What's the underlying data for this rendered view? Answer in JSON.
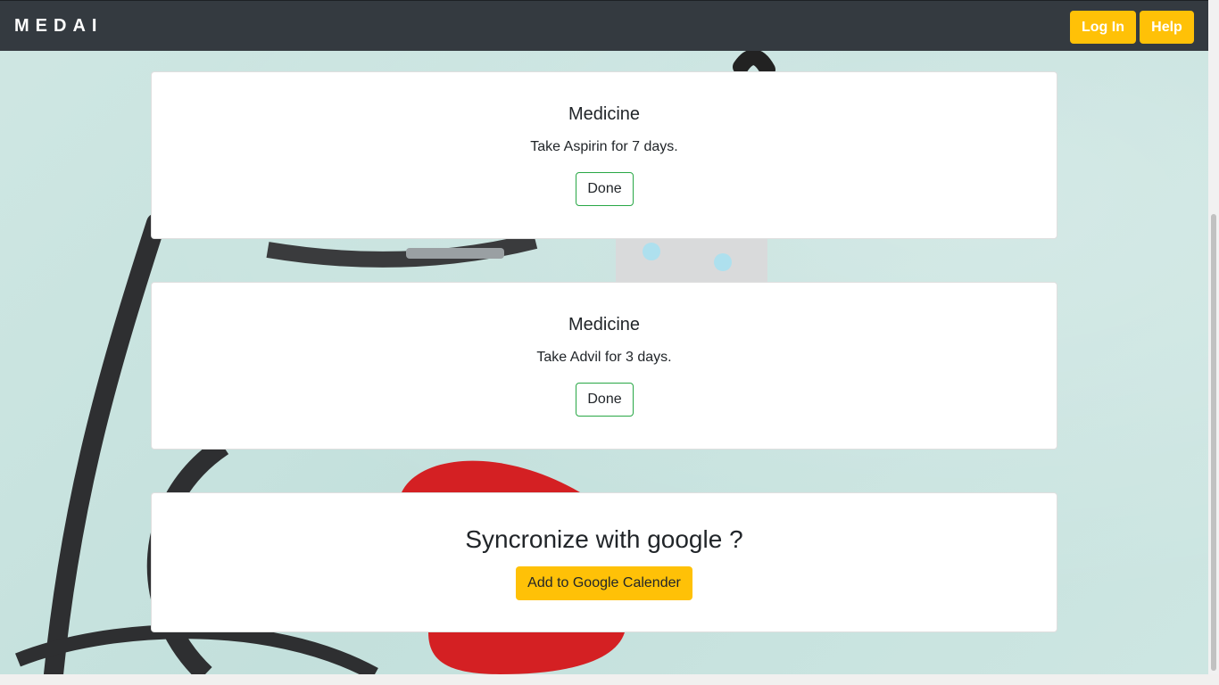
{
  "navbar": {
    "brand": "MEDAI",
    "login_label": "Log In",
    "help_label": "Help"
  },
  "reminders": [
    {
      "title": "Medicine",
      "text": "Take Aspirin for 7 days.",
      "button": "Done"
    },
    {
      "title": "Medicine",
      "text": "Take Advil for 3 days.",
      "button": "Done"
    }
  ],
  "sync": {
    "title": "Syncronize with google ?",
    "button": "Add to Google Calender"
  },
  "colors": {
    "navbar": "#343a40",
    "accent": "#ffc107",
    "done_border": "#28a745"
  }
}
